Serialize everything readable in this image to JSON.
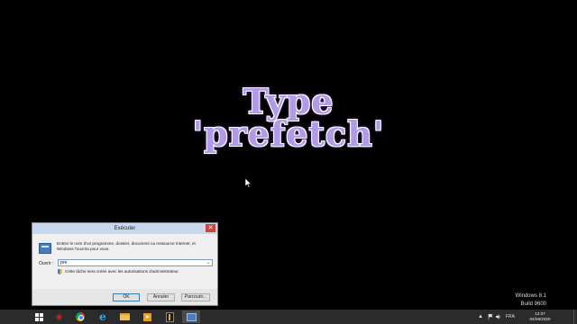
{
  "overlay": {
    "line1": "Type",
    "line2": "'prefetch'"
  },
  "run_dialog": {
    "title": "Exécuter",
    "close_glyph": "✕",
    "description": "Entrez le nom d'un programme, dossier, document ou ressource Internet, et Windows l'ouvrira pour vous.",
    "open_label": "Ouvrir :",
    "open_value": "pre",
    "admin_note": "Cette tâche sera créée avec les autorisations d'administrateur.",
    "buttons": {
      "ok": "OK",
      "cancel": "Annuler",
      "browse": "Parcourir..."
    }
  },
  "watermark": {
    "os": "Windows 8.1",
    "build": "Build 9600"
  },
  "taskbar": {
    "pinned": [
      "start-icon",
      "recorder-icon",
      "chrome-icon",
      "internet-explorer-icon",
      "file-explorer-icon",
      "media-player-icon",
      "app-icon",
      "run-dialog-icon"
    ],
    "tray_arrow": "▲",
    "language": "FRA",
    "time": "13:37",
    "date": "04/06/2020"
  },
  "colors": {
    "overlay_text": "#b19be8",
    "taskbar": "#2b2b2b",
    "desktop": "#000000"
  }
}
